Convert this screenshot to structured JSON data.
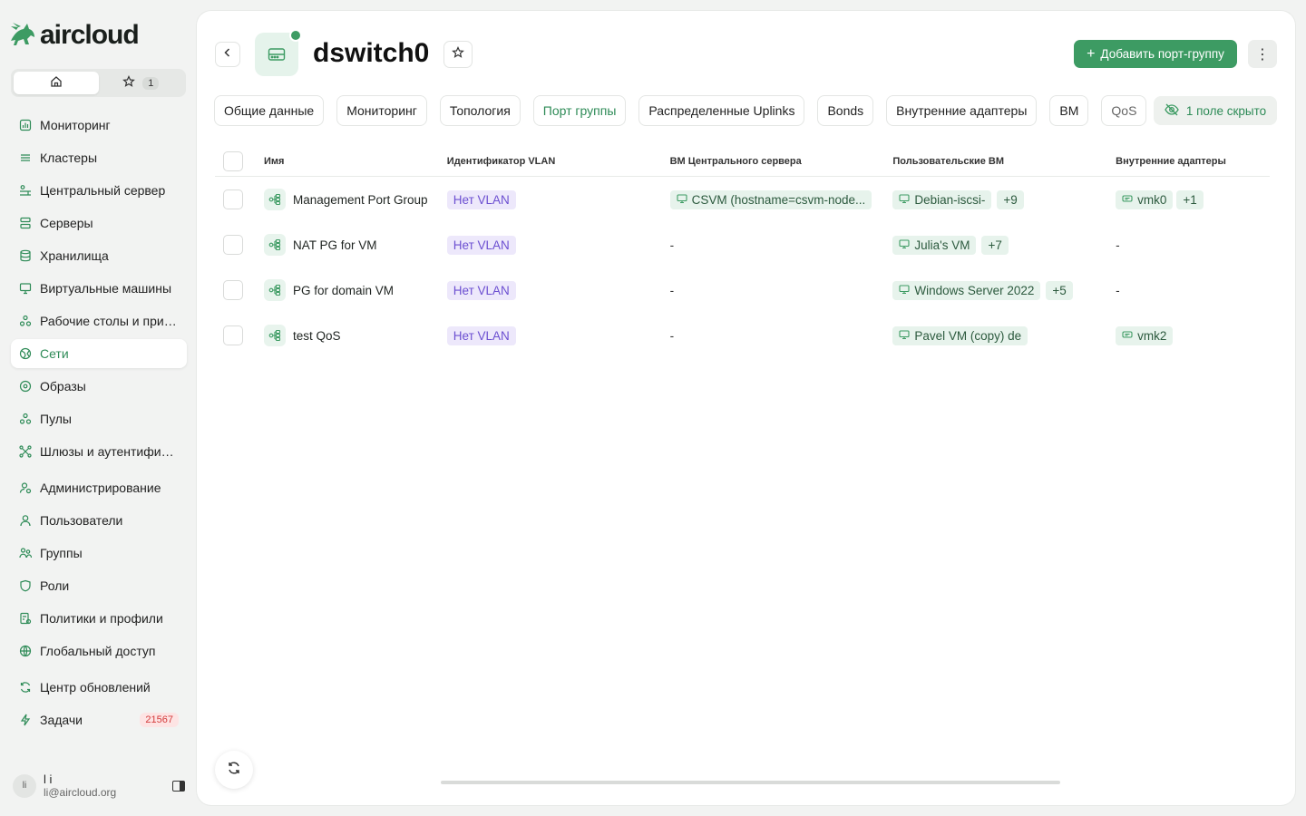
{
  "brand": {
    "name": "aircloud",
    "accent": "#3d9b63"
  },
  "quick_tabs": {
    "favorites_count": "1"
  },
  "nav": [
    {
      "label": "Мониторинг",
      "icon": "bar-chart-icon"
    },
    {
      "label": "Кластеры",
      "icon": "layers-icon"
    },
    {
      "label": "Центральный сервер",
      "icon": "central-server-icon"
    },
    {
      "label": "Серверы",
      "icon": "server-icon"
    },
    {
      "label": "Хранилища",
      "icon": "database-icon"
    },
    {
      "label": "Виртуальные машины",
      "icon": "monitor-icon"
    },
    {
      "label": "Рабочие столы и прил...",
      "icon": "apps-icon"
    },
    {
      "label": "Сети",
      "icon": "network-icon"
    },
    {
      "label": "Образы",
      "icon": "disc-icon"
    },
    {
      "label": "Пулы",
      "icon": "pool-icon"
    },
    {
      "label": "Шлюзы и аутентифика...",
      "icon": "gateway-icon"
    },
    {
      "label": "Администрирование",
      "icon": "admin-icon"
    },
    {
      "label": "Пользователи",
      "icon": "user-icon"
    },
    {
      "label": "Группы",
      "icon": "group-icon"
    },
    {
      "label": "Роли",
      "icon": "shield-icon"
    },
    {
      "label": "Политики и профили",
      "icon": "policy-icon"
    },
    {
      "label": "Глобальный доступ",
      "icon": "globe-icon"
    },
    {
      "label": "Центр обновлений",
      "icon": "refresh-icon"
    },
    {
      "label": "Задачи",
      "icon": "bolt-icon",
      "badge": "21567"
    }
  ],
  "user": {
    "initials": "li",
    "name": "l i",
    "email": "li@aircloud.org"
  },
  "header": {
    "title": "dswitch0",
    "add_label": "Добавить порт-группу",
    "status_color": "#3d9b63"
  },
  "tabs": [
    "Общие данные",
    "Мониторинг",
    "Топология",
    "Порт группы",
    "Распределенные Uplinks",
    "Bonds",
    "Внутренние адаптеры",
    "ВМ",
    "QoS"
  ],
  "hidden_fields_label": "1 поле скрыто",
  "table": {
    "columns": [
      "Имя",
      "Идентификатор VLAN",
      "ВМ Центрального сервера",
      "Пользовательские ВМ",
      "Внутренние адаптеры"
    ],
    "rows": [
      {
        "name": "Management Port Group",
        "vlan": "Нет VLAN",
        "csvm": "CSVM (hostname=csvm-node...",
        "uvm": "Debian-iscsi-",
        "uvm_more": "+9",
        "adapter": "vmk0",
        "adapter_more": "+1"
      },
      {
        "name": "NAT PG for VM",
        "vlan": "Нет VLAN",
        "csvm": "-",
        "uvm": "Julia's VM",
        "uvm_more": "+7",
        "adapter": "-",
        "adapter_more": ""
      },
      {
        "name": "PG for domain VM",
        "vlan": "Нет VLAN",
        "csvm": "-",
        "uvm": "Windows Server 2022",
        "uvm_more": "+5",
        "adapter": "-",
        "adapter_more": ""
      },
      {
        "name": "test QoS",
        "vlan": "Нет VLAN",
        "csvm": "-",
        "uvm": "Pavel VM (copy) de",
        "uvm_more": "",
        "adapter": "vmk2",
        "adapter_more": ""
      }
    ]
  }
}
